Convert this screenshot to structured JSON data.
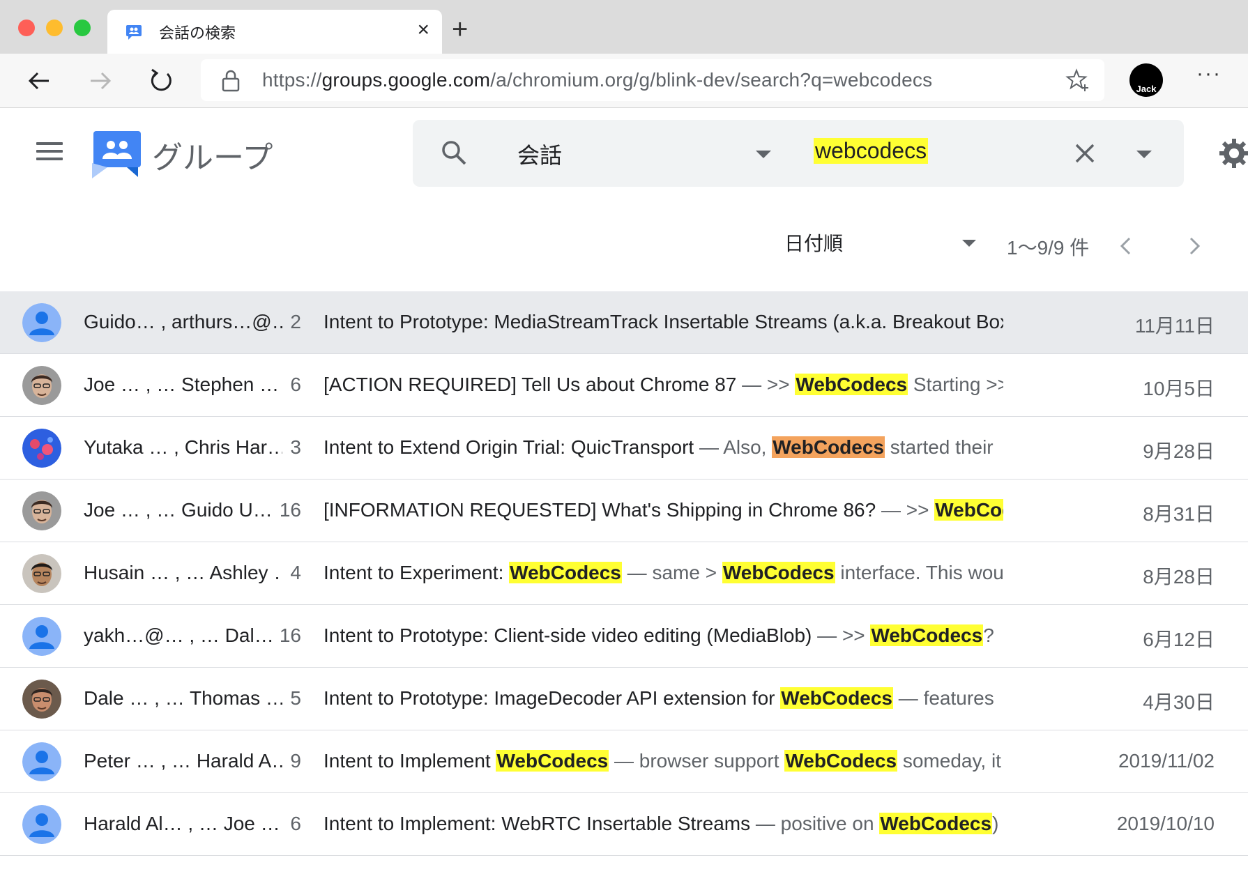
{
  "browser": {
    "tab_title": "会話の検索",
    "url_scheme": "https://",
    "url_host": "groups.google.com",
    "url_path": "/a/chromium.org/g/blink-dev/search?q=webcodecs",
    "profile_name": "Jack",
    "more_menu": "···"
  },
  "header": {
    "brand": "グループ",
    "search_scope": "会話",
    "search_query": "webcodecs"
  },
  "toolbar": {
    "sort_label": "日付順",
    "page_count": "1〜9/9 件"
  },
  "colors": {
    "highlight": "#ffff33",
    "highlight_current": "#f4a35d",
    "selected_row": "#e8eaed",
    "avatar_default": "#8ab4f8"
  },
  "conversations": [
    {
      "avatar": "default",
      "participants": "Guido… , arthurs…@…",
      "count": "2",
      "parts": [
        {
          "t": "Intent to Prototype: MediaStreamTrack Insertable Streams (a.k.a. Breakout Box)",
          "k": "s"
        }
      ],
      "date": "11月11日"
    },
    {
      "avatar": "photo-joe",
      "participants": "Joe …   , … Stephen …",
      "count": "6",
      "parts": [
        {
          "t": "[ACTION REQUIRED] Tell Us about Chrome 87",
          "k": "s"
        },
        {
          "t": " — >> ",
          "k": "n"
        },
        {
          "t": "WebCodecs",
          "k": "h"
        },
        {
          "t": " Starting >>> ",
          "k": "n"
        }
      ],
      "date": "10月5日"
    },
    {
      "avatar": "photo-yutaka",
      "participants": "Yutaka … , Chris Har…",
      "count": "3",
      "parts": [
        {
          "t": "Intent to Extend Origin Trial: QuicTransport",
          "k": "s"
        },
        {
          "t": " — Also, ",
          "k": "n"
        },
        {
          "t": "WebCodecs",
          "k": "o"
        },
        {
          "t": " started their",
          "k": "n"
        }
      ],
      "date": "9月28日"
    },
    {
      "avatar": "photo-joe",
      "participants": "Joe …   , … Guido U…",
      "count": "16",
      "parts": [
        {
          "t": "[INFORMATION REQUESTED] What's Shipping in Chrome 86?",
          "k": "s"
        },
        {
          "t": " — >> ",
          "k": "n"
        },
        {
          "t": "WebCodecs",
          "k": "h"
        }
      ],
      "date": "8月31日"
    },
    {
      "avatar": "photo-husain",
      "participants": "Husain … , … Ashley …",
      "count": "4",
      "parts": [
        {
          "t": "Intent to Experiment: ",
          "k": "s"
        },
        {
          "t": "WebCodecs",
          "k": "h"
        },
        {
          "t": " — same > ",
          "k": "n"
        },
        {
          "t": "WebCodecs",
          "k": "h"
        },
        {
          "t": " interface. This would",
          "k": "n"
        }
      ],
      "date": "8月28日"
    },
    {
      "avatar": "default",
      "participants": "yakh…@…   , … Dal…",
      "count": "16",
      "parts": [
        {
          "t": "Intent to Prototype: Client-side video editing (MediaBlob)",
          "k": "s"
        },
        {
          "t": " — >> ",
          "k": "n"
        },
        {
          "t": "WebCodecs",
          "k": "h"
        },
        {
          "t": "?",
          "k": "n"
        }
      ],
      "date": "6月12日"
    },
    {
      "avatar": "photo-dale",
      "participants": "Dale … , … Thomas …",
      "count": "5",
      "parts": [
        {
          "t": "Intent to Prototype: ImageDecoder API extension for ",
          "k": "s"
        },
        {
          "t": "WebCodecs",
          "k": "h"
        },
        {
          "t": " — features",
          "k": "n"
        }
      ],
      "date": "4月30日"
    },
    {
      "avatar": "default",
      "participants": "Peter … , … Harald A…",
      "count": "9",
      "parts": [
        {
          "t": "Intent to Implement ",
          "k": "s"
        },
        {
          "t": "WebCodecs",
          "k": "h"
        },
        {
          "t": " — browser support ",
          "k": "n"
        },
        {
          "t": "WebCodecs",
          "k": "h"
        },
        {
          "t": " someday, it",
          "k": "n"
        }
      ],
      "date": "2019/11/02"
    },
    {
      "avatar": "default",
      "participants": "Harald Al… , … Joe …",
      "count": "6",
      "parts": [
        {
          "t": "Intent to Implement: WebRTC Insertable Streams",
          "k": "s"
        },
        {
          "t": " — positive on ",
          "k": "n"
        },
        {
          "t": "WebCodecs",
          "k": "h"
        },
        {
          "t": ")",
          "k": "n"
        }
      ],
      "date": "2019/10/10"
    }
  ]
}
